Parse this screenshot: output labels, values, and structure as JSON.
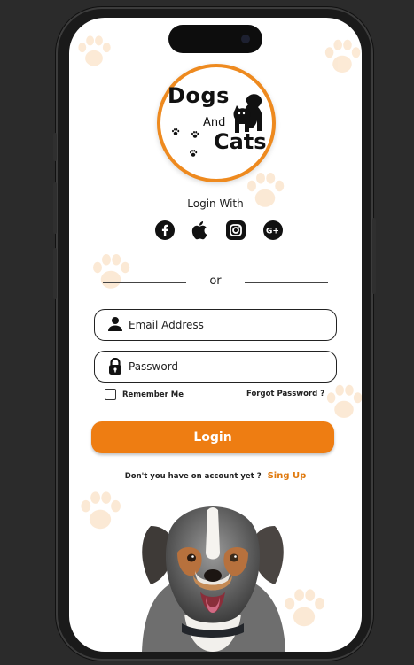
{
  "logo": {
    "line1": "Dogs",
    "line2": "And",
    "line3": "Cats"
  },
  "login_with": "Login With",
  "socials": [
    {
      "name": "facebook"
    },
    {
      "name": "apple"
    },
    {
      "name": "instagram"
    },
    {
      "name": "google-plus"
    }
  ],
  "divider_text": "or",
  "email": {
    "placeholder": "Email Address",
    "value": ""
  },
  "password": {
    "placeholder": "Password",
    "value": ""
  },
  "remember_me": {
    "label": "Remember Me",
    "checked": false
  },
  "forgot_password": "Forgot Password ?",
  "login_button": "Login",
  "signup": {
    "prompt": "Don't you have on account yet ?",
    "link": "Sing Up"
  },
  "colors": {
    "accent": "#ee7d12",
    "background": "#2b2b2b",
    "screen": "#ffffff"
  }
}
